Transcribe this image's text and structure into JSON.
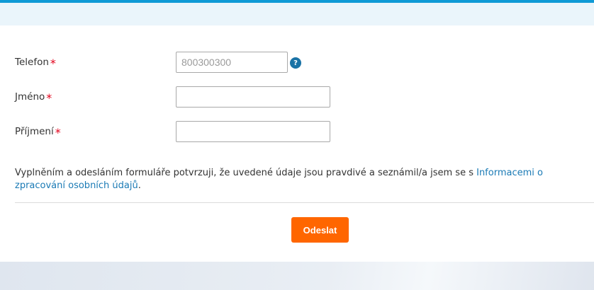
{
  "form": {
    "phone": {
      "label": "Telefon",
      "required_mark": "*",
      "placeholder": "800300300",
      "value": ""
    },
    "first_name": {
      "label": "Jméno",
      "required_mark": "*",
      "value": ""
    },
    "last_name": {
      "label": "Příjmení",
      "required_mark": "*",
      "value": ""
    },
    "help_icon_glyph": "?",
    "consent": {
      "text_before": "Vyplněním a odesláním formuláře potvrzuji, že uvedené údaje jsou pravdivé a seznámil/a jsem se s ",
      "link_text": "Informacemi o zpracování osobních údajů",
      "text_after": "."
    },
    "submit_label": "Odeslat"
  },
  "colors": {
    "accent_blue": "#0f9ad6",
    "link": "#1a7ab5",
    "required": "#e2001a",
    "submit_bg": "#ff6600"
  }
}
